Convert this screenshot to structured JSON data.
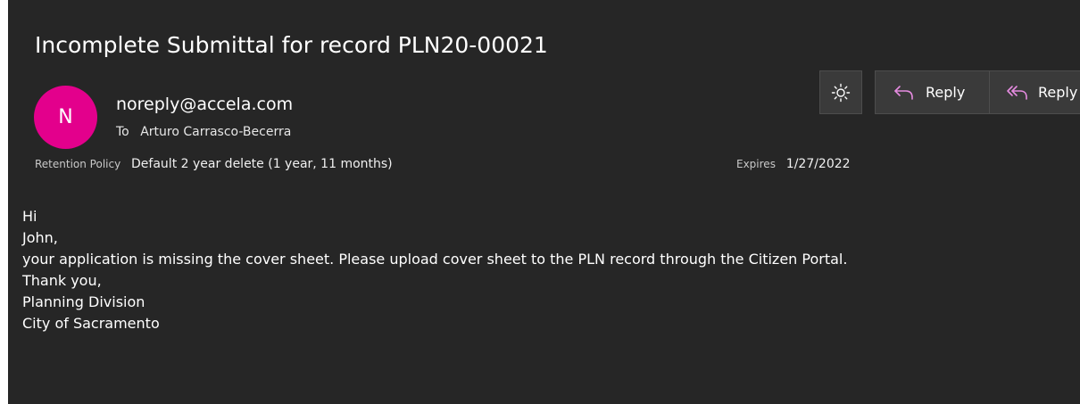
{
  "message": {
    "subject": "Incomplete Submittal for record PLN20-00021",
    "sender": {
      "initial": "N",
      "email": "noreply@accela.com",
      "avatar_color": "#e3008c"
    },
    "to": {
      "label": "To",
      "name": "Arturo Carrasco-Becerra"
    },
    "retention": {
      "label": "Retention Policy",
      "value": "Default 2 year delete (1 year, 11 months)"
    },
    "expires": {
      "label": "Expires",
      "value": "1/27/2022"
    },
    "body": [
      "Hi",
      "John,",
      "your application is missing the cover sheet. Please upload cover sheet to the PLN record through the Citizen Portal.",
      "Thank you,",
      "Planning Division",
      "City of Sacramento"
    ]
  },
  "toolbar": {
    "theme_icon": "sun-icon",
    "reply_label": "Reply",
    "reply_icon": "reply-arrow-icon",
    "reply_all_label": "Reply",
    "reply_all_icon": "reply-all-arrow-icon"
  },
  "colors": {
    "background": "#262626",
    "button_background": "#3a3a3a",
    "icon_accent": "#e58be0"
  }
}
